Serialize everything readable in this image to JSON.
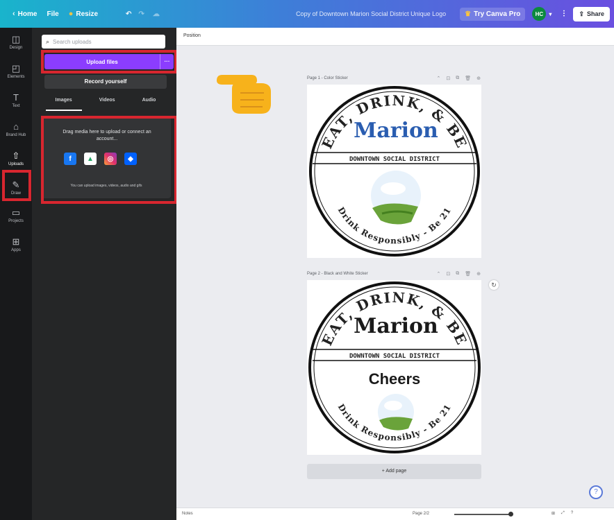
{
  "topbar": {
    "home": "Home",
    "file": "File",
    "resize": "Resize",
    "title": "Copy of Downtown Marion Social District Unique Logo",
    "try_pro": "Try Canva Pro",
    "avatar": "HC",
    "share": "Share"
  },
  "rail": {
    "items": [
      {
        "label": "Design",
        "icon": "layout-icon"
      },
      {
        "label": "Elements",
        "icon": "shapes-icon"
      },
      {
        "label": "Text",
        "icon": "text-icon"
      },
      {
        "label": "Brand Hub",
        "icon": "brand-icon"
      },
      {
        "label": "Uploads",
        "icon": "upload-icon"
      },
      {
        "label": "Draw",
        "icon": "pen-icon"
      },
      {
        "label": "Projects",
        "icon": "folder-icon"
      },
      {
        "label": "Apps",
        "icon": "grid-icon"
      }
    ]
  },
  "panel": {
    "search_placeholder": "Search uploads",
    "upload_button": "Upload files",
    "upload_more": "···",
    "record_button": "Record yourself",
    "tabs": [
      "Images",
      "Videos",
      "Audio"
    ],
    "drop_text": "Drag media here to upload or connect an account...",
    "sources": [
      "Facebook",
      "Google Drive",
      "Instagram",
      "Dropbox"
    ],
    "hint": "You can upload images, videos, audio and gifs"
  },
  "canvas": {
    "position_label": "Position",
    "pages": [
      {
        "label": "Page 1 - Color Sticker",
        "top_text": "EAT, DRINK, & BE",
        "brand": "Marion",
        "band_text": "DOWNTOWN SOCIAL DISTRICT",
        "bottom_text": "Drink Responsibly - Be 21",
        "center_text": ""
      },
      {
        "label": "Page 2 - Black and White Sticker",
        "top_text": "EAT, DRINK, & BE",
        "brand": "Marion",
        "band_text": "DOWNTOWN SOCIAL DISTRICT",
        "bottom_text": "Drink Responsibly - Be 21",
        "center_text": "Cheers"
      }
    ],
    "add_page": "+ Add page",
    "notes": "Notes",
    "zoom": "Page 2/2"
  },
  "colors": {
    "accent": "#8b3dff",
    "highlight": "#d8262f",
    "brand_blue": "#2a5db0"
  }
}
